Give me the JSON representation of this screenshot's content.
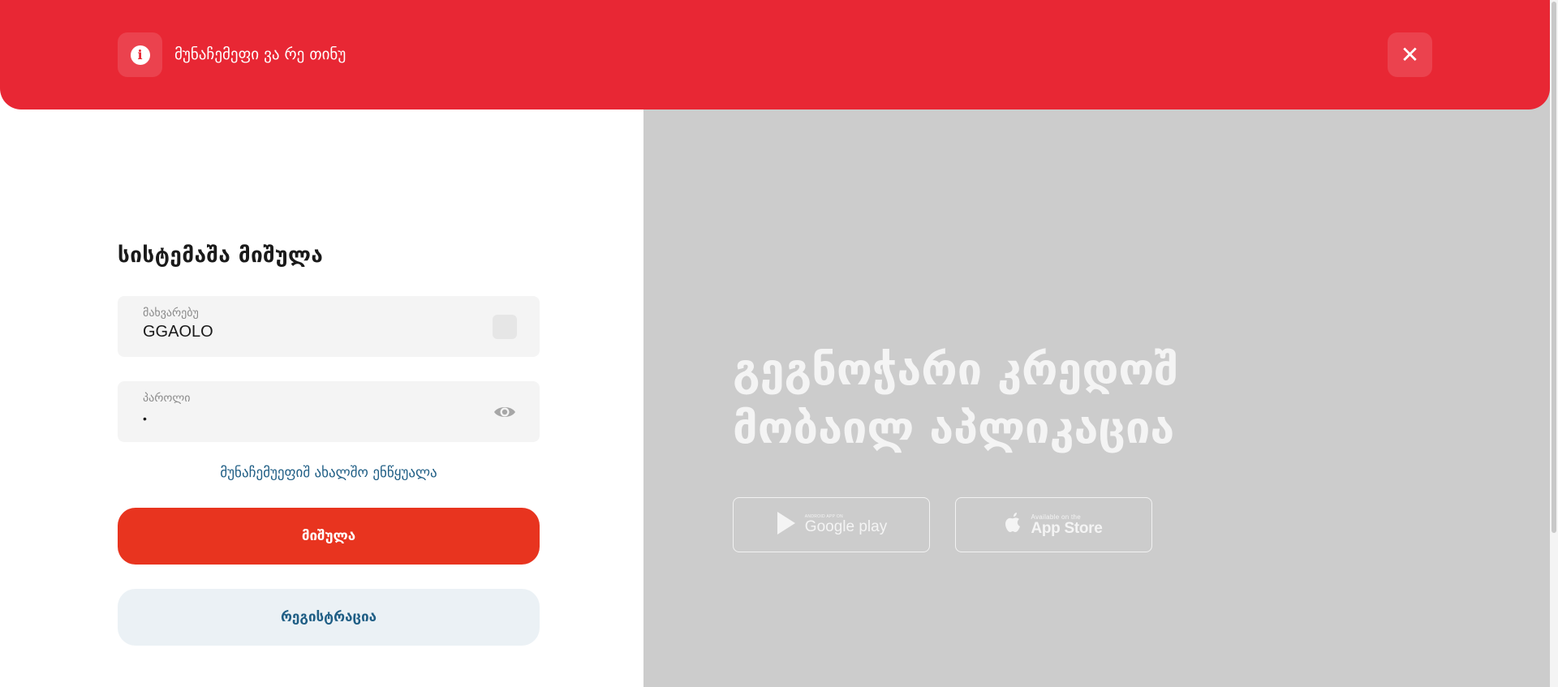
{
  "banner": {
    "message": "მუნაჩემეფი ვა რე თინუ",
    "info_icon": "info-icon",
    "close_glyph": "✕",
    "background_color": "#e82734"
  },
  "login": {
    "title": "სისტემაშა მიშულა",
    "username": {
      "label": "მახვარებუ",
      "value": "GGAOLO"
    },
    "password": {
      "label": "პაროლი",
      "value": "•"
    },
    "forgot_link": "მუნაჩემუეფიშ ახალშო ენწყუალა",
    "login_button": "მიშულა",
    "register_button": "რეგისტრაცია",
    "accent_color": "#e8341f",
    "link_color": "#1f5e85"
  },
  "promo": {
    "title_line1": "გეგნოჭარი კრედოშ",
    "title_line2": "მობაილ აპლიკაცია",
    "google_play": {
      "small": "ANDROID APP ON",
      "big": "Google play"
    },
    "app_store": {
      "small": "Available on the",
      "big": "App Store"
    },
    "background_color": "#cccccc"
  }
}
